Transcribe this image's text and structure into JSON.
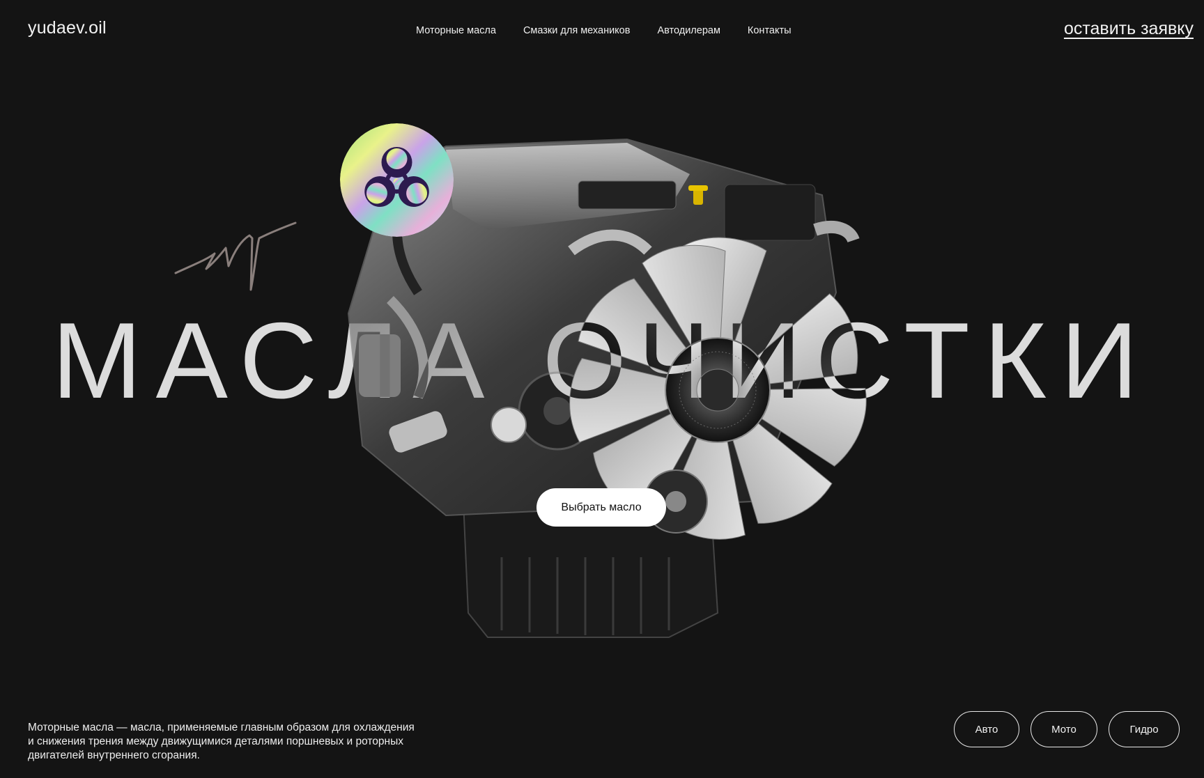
{
  "header": {
    "logo": "yudaev.oil",
    "nav": [
      {
        "label": "Моторные масла"
      },
      {
        "label": "Смазки для механиков"
      },
      {
        "label": "Автодилерам"
      },
      {
        "label": "Контакты"
      }
    ],
    "cta": "оставить заявку"
  },
  "hero": {
    "title": "МАСЛА ОЧИСТКИ",
    "badge_icon": "biohazard-icon",
    "signature_icon": "signature-icon",
    "image": "engine-image",
    "button": "Выбрать масло"
  },
  "footer": {
    "description": "Моторные масла — масла, применяемые главным образом для охлаждения и снижения трения между движущимися деталями поршневых и роторных двигателей внутреннего сгорания.",
    "categories": [
      {
        "label": "Авто"
      },
      {
        "label": "Мото"
      },
      {
        "label": "Гидро"
      }
    ]
  },
  "colors": {
    "background": "#141414",
    "text": "#f0f0f0",
    "button_bg": "#ffffff"
  }
}
